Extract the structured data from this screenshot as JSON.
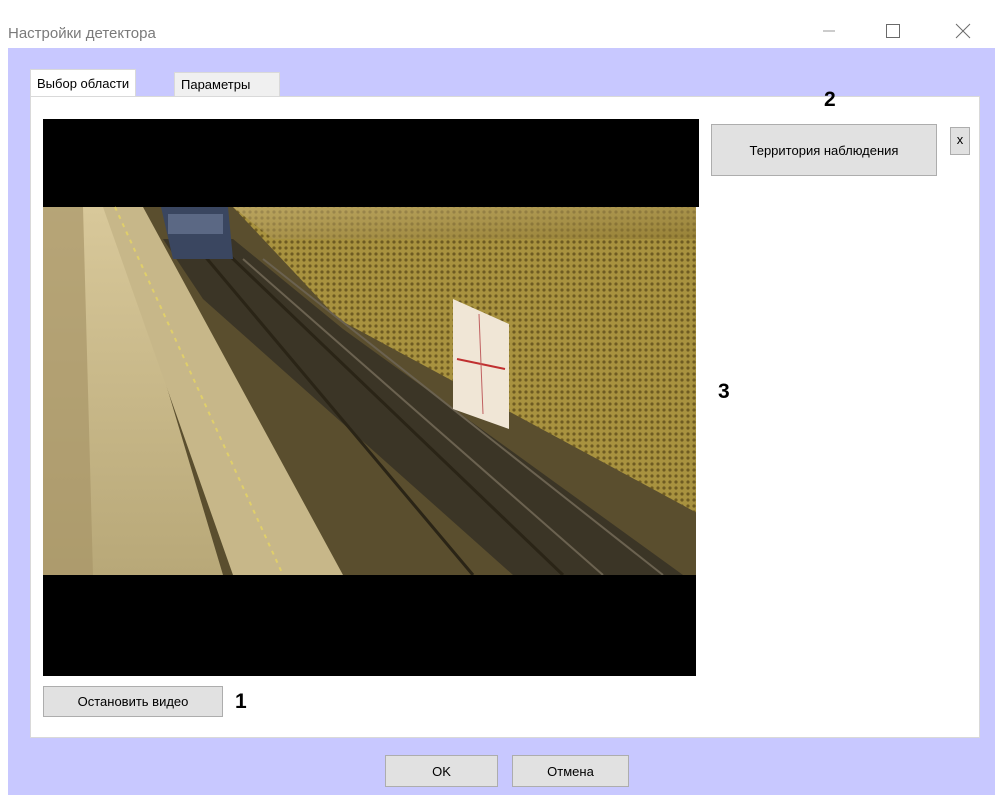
{
  "window": {
    "title": "Настройки детектора",
    "minimize_icon": "minimize-icon",
    "maximize_icon": "maximize-icon",
    "close_icon": "close-icon"
  },
  "tabs": [
    {
      "label": "Выбор области",
      "active": true
    },
    {
      "label": "Параметры",
      "active": false
    }
  ],
  "zone_panel": {
    "zone_button_label": "Территория наблюдения",
    "delete_label": "x"
  },
  "video": {
    "stop_button_label": "Остановить видео"
  },
  "dialog_buttons": {
    "ok_label": "OK",
    "cancel_label": "Отмена"
  },
  "callouts": {
    "one": "1",
    "two": "2",
    "three": "3"
  },
  "colors": {
    "client_background": "#c8c8ff",
    "button_face": "#e1e1e1"
  }
}
